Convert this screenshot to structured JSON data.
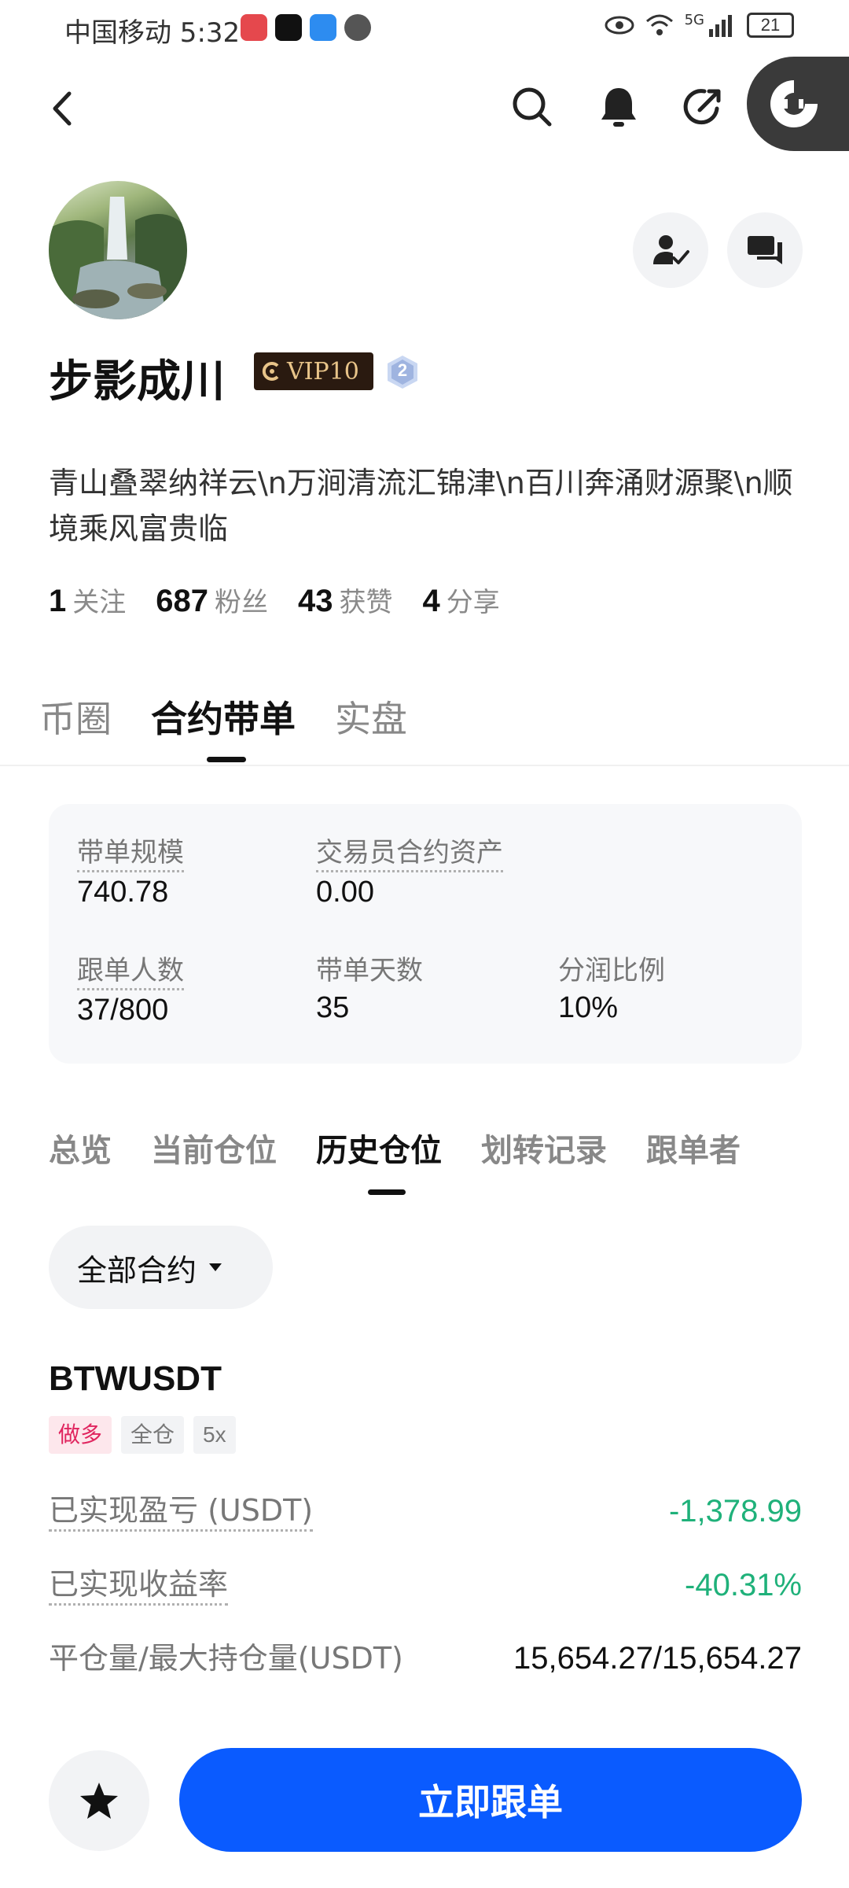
{
  "status_bar": {
    "carrier_time": "中国移动 5:32",
    "network": "5G",
    "battery": "21"
  },
  "profile": {
    "name": "步影成川",
    "vip": "VIP10",
    "level": "2",
    "bio": "青山叠翠纳祥云\\n万涧清流汇锦津\\n百川奔涌财源聚\\n顺境乘风富贵临",
    "stats": [
      {
        "value": "1",
        "label": "关注"
      },
      {
        "value": "687",
        "label": "粉丝"
      },
      {
        "value": "43",
        "label": "获赞"
      },
      {
        "value": "4",
        "label": "分享"
      }
    ]
  },
  "main_tabs": [
    "币圈",
    "合约带单",
    "实盘"
  ],
  "card": {
    "scale_label": "带单规模",
    "scale_value": "740.78",
    "asset_label": "交易员合约资产",
    "asset_value": "0.00",
    "followers_label": "跟单人数",
    "followers_value": "37/800",
    "days_label": "带单天数",
    "days_value": "35",
    "share_label": "分润比例",
    "share_value": "10%"
  },
  "sub_tabs": [
    "总览",
    "当前仓位",
    "历史仓位",
    "划转记录",
    "跟单者"
  ],
  "filter": {
    "label": "全部合约"
  },
  "position": {
    "symbol": "BTWUSDT",
    "tags": [
      "做多",
      "全仓",
      "5x"
    ],
    "pnl_label": "已实现盈亏 (USDT)",
    "pnl_value": "-1,378.99",
    "roi_label": "已实现收益率",
    "roi_value": "-40.31%",
    "volume_label": "平仓量/最大持仓量(USDT)",
    "volume_value": "15,654.27/15,654.27"
  },
  "cta": {
    "label": "立即跟单"
  },
  "colors": {
    "accent": "#0a5bff",
    "profit_text": "#1fb17a",
    "long_tag": "#e0245e"
  }
}
